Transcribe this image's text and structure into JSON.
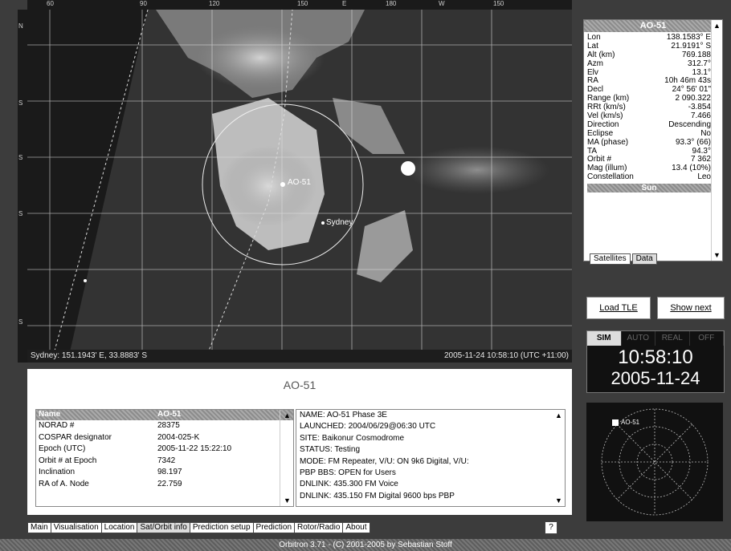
{
  "map": {
    "lon_labels": [
      "60",
      "90",
      "120",
      "150",
      "E",
      "180",
      "W",
      "150"
    ],
    "lat_labels": [
      "N",
      "S",
      "S",
      "S",
      "S"
    ],
    "satellite_label": "AO-51",
    "sun_marker": "sun-icon",
    "city_label": "Sydney",
    "status_left": "Sydney: 151.1943' E, 33.8883' S",
    "status_right": "2005-11-24 10:58:10 (UTC +11:00)"
  },
  "sat_panel": {
    "title": "AO-51",
    "rows": [
      {
        "label": "Lon",
        "value": "138.1583° E"
      },
      {
        "label": "Lat",
        "value": "21.9191° S"
      },
      {
        "label": "Alt (km)",
        "value": "769.188"
      },
      {
        "label": "Azm",
        "value": "312.7°"
      },
      {
        "label": "Elv",
        "value": "13.1°"
      },
      {
        "label": "RA",
        "value": "10h 46m 43s"
      },
      {
        "label": "Decl",
        "value": "24° 56' 01\""
      },
      {
        "label": "Range (km)",
        "value": "2 090.322"
      },
      {
        "label": "RRt (km/s)",
        "value": "-3.854"
      },
      {
        "label": "Vel (km/s)",
        "value": "7.466"
      },
      {
        "label": "Direction",
        "value": "Descending"
      },
      {
        "label": "Eclipse",
        "value": "No"
      },
      {
        "label": "MA (phase)",
        "value": "93.3° (66)"
      },
      {
        "label": "TA",
        "value": "94.3°"
      },
      {
        "label": "Orbit #",
        "value": "7 362"
      },
      {
        "label": "Mag (illum)",
        "value": "13.4 (10%)"
      },
      {
        "label": "Constellation",
        "value": "Leo"
      }
    ],
    "sun_header": "Sun",
    "tabs": [
      "Satellites",
      "Data"
    ]
  },
  "buttons": {
    "load_tle": "Load TLE",
    "show_next": "Show next"
  },
  "clock": {
    "tabs": [
      "SIM",
      "AUTO",
      "REAL",
      "OFF"
    ],
    "time": "10:58:10",
    "date": "2005-11-24"
  },
  "polar": {
    "sat_label": "AO-51"
  },
  "info": {
    "title": "AO-51",
    "table_header": [
      "Name",
      "AO-51"
    ],
    "table_rows": [
      {
        "k": "NORAD #",
        "v": "28375"
      },
      {
        "k": "COSPAR designator",
        "v": "2004-025-K"
      },
      {
        "k": "Epoch (UTC)",
        "v": "2005-11-22 15:22:10"
      },
      {
        "k": "Orbit # at Epoch",
        "v": "7342"
      },
      {
        "k": "Inclination",
        "v": "98.197"
      },
      {
        "k": "RA of A. Node",
        "v": "22.759"
      }
    ],
    "notes": [
      "NAME: AO-51 Phase 3E",
      "LAUNCHED: 2004/06/29@06:30 UTC",
      "SITE: Baikonur Cosmodrome",
      "STATUS: Testing",
      "MODE: FM Repeater, V/U: ON    9k6 Digital, V/U:",
      "PBP BBS: OPEN for Users",
      "DNLINK: 435.300 FM Voice",
      "DNLINK: 435.150 FM Digital 9600 bps PBP"
    ]
  },
  "bottom_tabs": [
    "Main",
    "Visualisation",
    "Location",
    "Sat/Orbit info",
    "Prediction setup",
    "Prediction",
    "Rotor/Radio",
    "About"
  ],
  "help": "?",
  "footer": "Orbitron 3.71 - (C) 2001-2005 by Sebastian Stoff"
}
